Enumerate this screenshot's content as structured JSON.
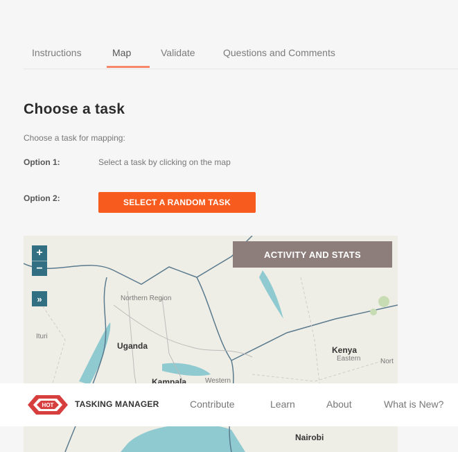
{
  "tabs": [
    {
      "label": "Instructions"
    },
    {
      "label": "Map"
    },
    {
      "label": "Validate"
    },
    {
      "label": "Questions and Comments"
    }
  ],
  "content": {
    "title": "Choose a task",
    "subtitle": "Choose a task for mapping:",
    "option1_label": "Option 1:",
    "option1_text": "Select a task by clicking on the map",
    "option2_label": "Option 2:",
    "random_button": "SELECT A RANDOM TASK"
  },
  "map": {
    "zoom_in": "+",
    "zoom_out": "−",
    "expand": "»",
    "stats_button": "ACTIVITY AND STATS",
    "labels": {
      "northern_region": "Northern Region",
      "ituri": "Ituri",
      "uganda": "Uganda",
      "kenya": "Kenya",
      "eastern": "Eastern",
      "kampala": "Kampala",
      "nairobi": "Nairobi",
      "western": "Western",
      "nort": "Nort"
    }
  },
  "navbar": {
    "logo_text": "HOT",
    "brand": "TASKING MANAGER",
    "links": [
      "Contribute",
      "Learn",
      "About",
      "What is New?"
    ]
  },
  "colors": {
    "accent": "#f75c1e",
    "tab_underline": "#f7876a",
    "map_control": "#336f82",
    "stats_button": "#8d7d7b",
    "water": "#8ecad0",
    "logo_red": "#d73f3f"
  }
}
